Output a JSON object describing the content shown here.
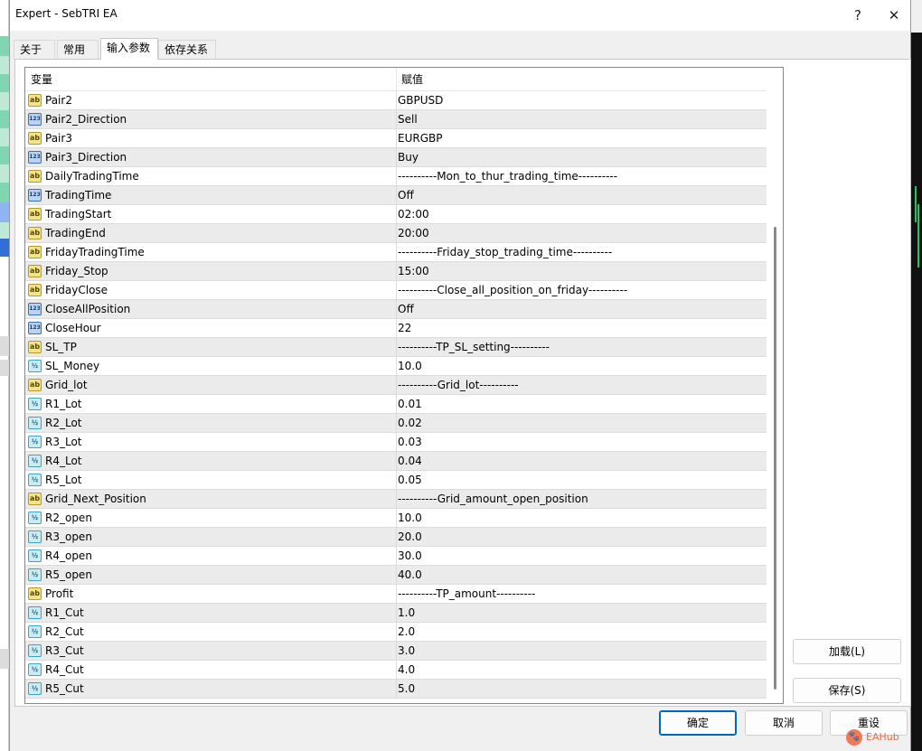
{
  "window": {
    "title": "Expert - SebTRI EA",
    "help_glyph": "?",
    "close_glyph": "✕"
  },
  "tabs": [
    {
      "label": "关于"
    },
    {
      "label": "常用"
    },
    {
      "label": "输入参数"
    },
    {
      "label": "依存关系"
    }
  ],
  "grid": {
    "col_variable": "变量",
    "col_value": "赋值",
    "rows": [
      {
        "type": "ab",
        "name": "Pair2",
        "value": "GBPUSD"
      },
      {
        "type": "123",
        "name": "Pair2_Direction",
        "value": "Sell"
      },
      {
        "type": "ab",
        "name": "Pair3",
        "value": "EURGBP"
      },
      {
        "type": "123",
        "name": "Pair3_Direction",
        "value": "Buy"
      },
      {
        "type": "ab",
        "name": "DailyTradingTime",
        "value": "----------Mon_to_thur_trading_time----------"
      },
      {
        "type": "123",
        "name": "TradingTime",
        "value": "Off"
      },
      {
        "type": "ab",
        "name": "TradingStart",
        "value": "02:00"
      },
      {
        "type": "ab",
        "name": "TradingEnd",
        "value": "20:00"
      },
      {
        "type": "ab",
        "name": "FridayTradingTime",
        "value": "----------Friday_stop_trading_time----------"
      },
      {
        "type": "ab",
        "name": "Friday_Stop",
        "value": "15:00"
      },
      {
        "type": "ab",
        "name": "FridayClose",
        "value": "----------Close_all_position_on_friday----------"
      },
      {
        "type": "123",
        "name": "CloseAllPosition",
        "value": "Off"
      },
      {
        "type": "123",
        "name": "CloseHour",
        "value": "22"
      },
      {
        "type": "ab",
        "name": "SL_TP",
        "value": "----------TP_SL_setting----------"
      },
      {
        "type": "half",
        "name": "SL_Money",
        "value": "10.0"
      },
      {
        "type": "ab",
        "name": "Grid_lot",
        "value": "----------Grid_lot----------"
      },
      {
        "type": "half",
        "name": "R1_Lot",
        "value": "0.01"
      },
      {
        "type": "half",
        "name": "R2_Lot",
        "value": "0.02"
      },
      {
        "type": "half",
        "name": "R3_Lot",
        "value": "0.03"
      },
      {
        "type": "half",
        "name": "R4_Lot",
        "value": "0.04"
      },
      {
        "type": "half",
        "name": "R5_Lot",
        "value": "0.05"
      },
      {
        "type": "ab",
        "name": "Grid_Next_Position",
        "value": "----------Grid_amount_open_position"
      },
      {
        "type": "half",
        "name": "R2_open",
        "value": "10.0"
      },
      {
        "type": "half",
        "name": "R3_open",
        "value": "20.0"
      },
      {
        "type": "half",
        "name": "R4_open",
        "value": "30.0"
      },
      {
        "type": "half",
        "name": "R5_open",
        "value": "40.0"
      },
      {
        "type": "ab",
        "name": "Profit",
        "value": "----------TP_amount----------"
      },
      {
        "type": "half",
        "name": "R1_Cut",
        "value": "1.0"
      },
      {
        "type": "half",
        "name": "R2_Cut",
        "value": "2.0"
      },
      {
        "type": "half",
        "name": "R3_Cut",
        "value": "3.0"
      },
      {
        "type": "half",
        "name": "R4_Cut",
        "value": "4.0"
      },
      {
        "type": "half",
        "name": "R5_Cut",
        "value": "5.0"
      }
    ]
  },
  "icon_glyphs": {
    "ab": "ab",
    "123": "123",
    "half": "½"
  },
  "side_buttons": {
    "load": "加载(L)",
    "save": "保存(S)"
  },
  "footer": {
    "ok": "确定",
    "cancel": "取消",
    "reset": "重设"
  },
  "watermark": {
    "text": "EAHub"
  }
}
